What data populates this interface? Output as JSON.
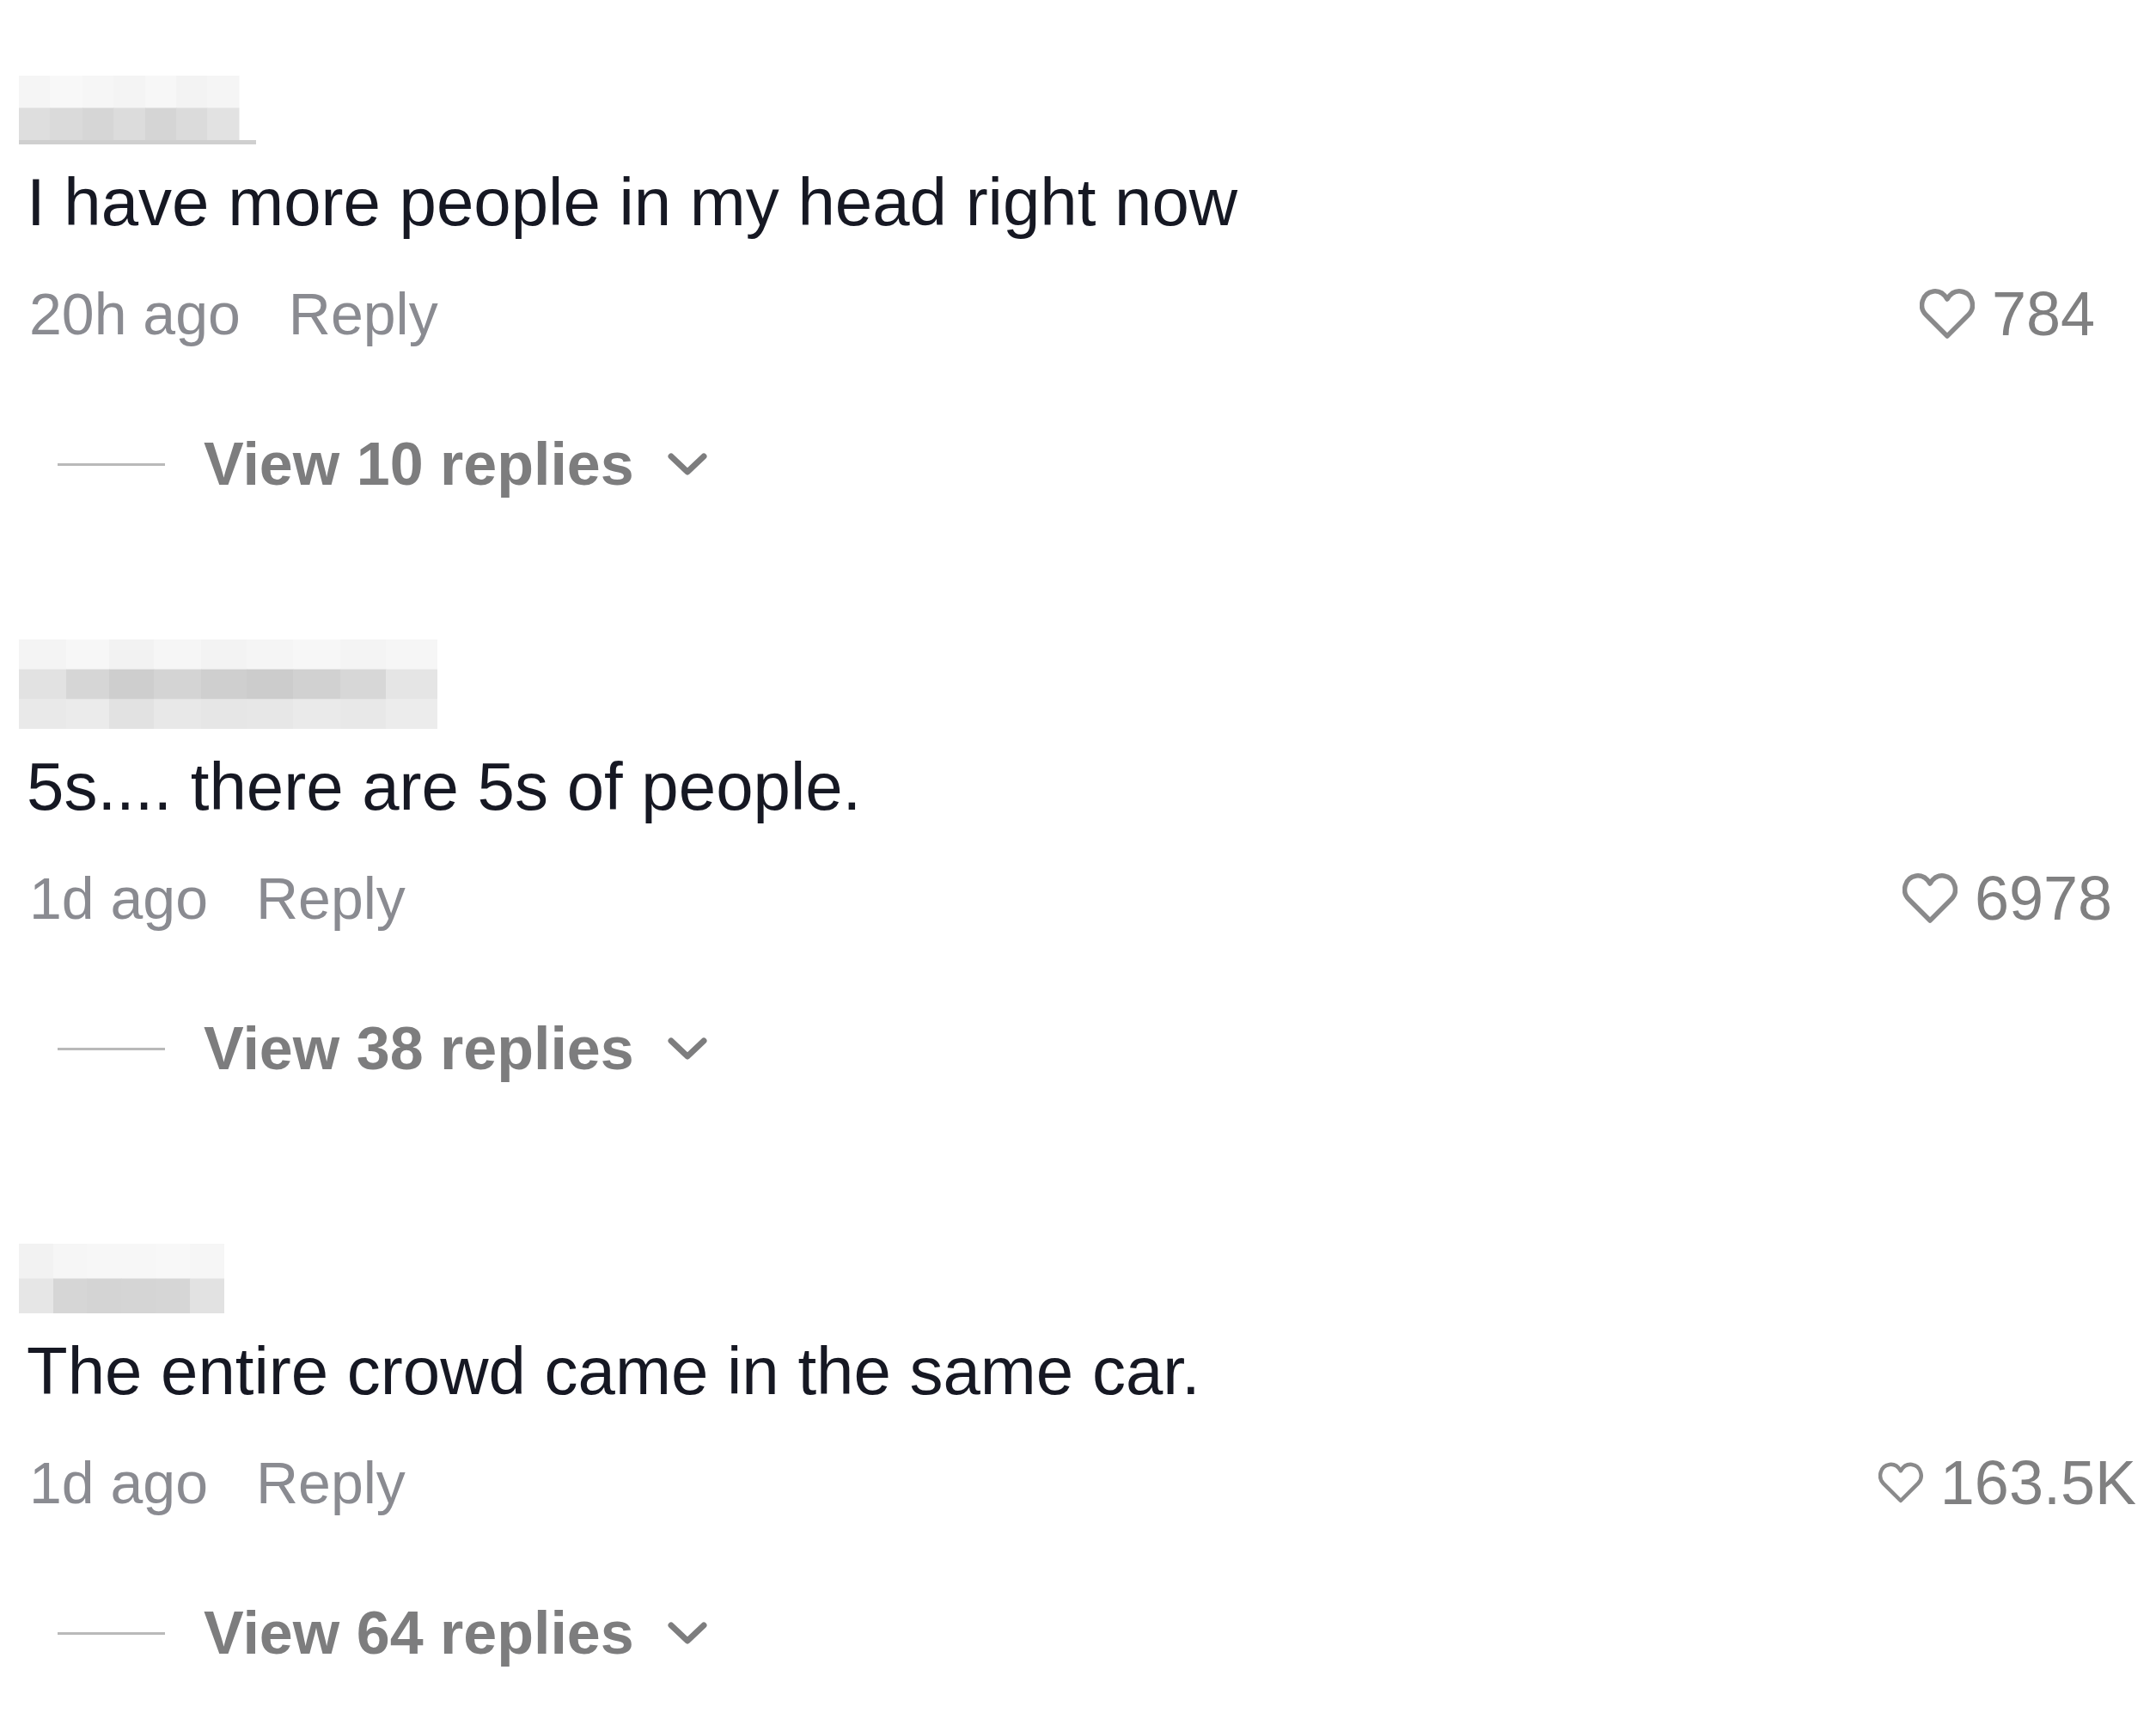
{
  "comments": [
    {
      "text": "I have more people in my head right now",
      "time": "20h ago",
      "reply_label": "Reply",
      "likes": "784",
      "liked": false,
      "view_replies": "View 10 replies"
    },
    {
      "text": "5s.... there are 5s of people.",
      "time": "1d ago",
      "reply_label": "Reply",
      "likes": "6978",
      "liked": false,
      "view_replies": "View 38 replies"
    },
    {
      "text": "The entire crowd came in the same car.",
      "time": "1d ago",
      "reply_label": "Reply",
      "likes": "163.5K",
      "liked": false,
      "view_replies": "View 64 replies"
    }
  ]
}
